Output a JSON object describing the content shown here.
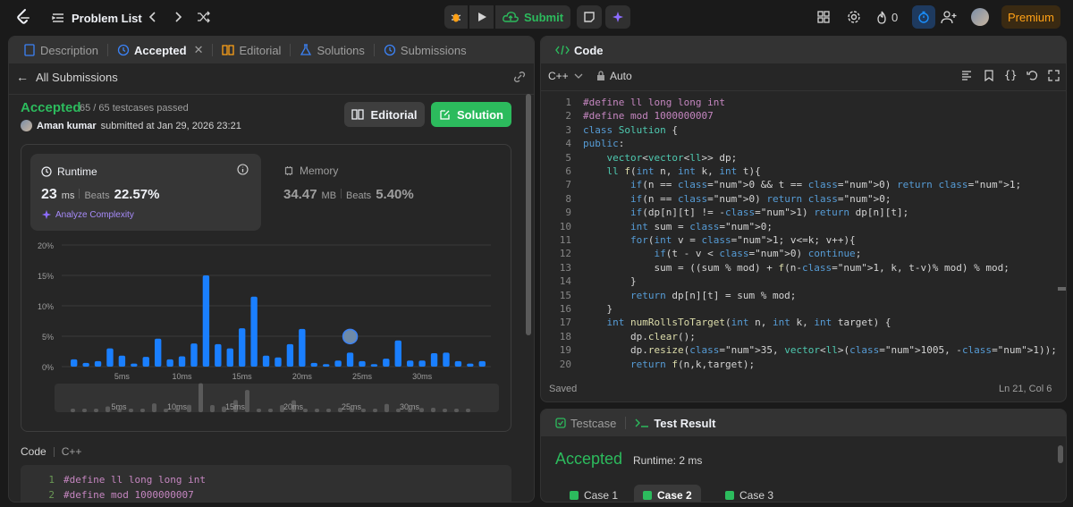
{
  "topbar": {
    "problem_list": "Problem List",
    "submit": "Submit",
    "streak_count": "0",
    "premium": "Premium",
    "icons": [
      "leetcode-logo-icon",
      "list-icon",
      "chevron-left-icon",
      "chevron-right-icon",
      "shuffle-icon",
      "debug-icon",
      "play-icon",
      "cloud-upload-icon",
      "note-icon",
      "sparkle-icon",
      "layout-icon",
      "gear-icon",
      "fire-icon",
      "timer-icon",
      "add-user-icon",
      "avatar"
    ]
  },
  "left_tabs": [
    {
      "label": "Description",
      "active": false
    },
    {
      "label": "Accepted",
      "active": true
    },
    {
      "label": "Editorial",
      "active": false
    },
    {
      "label": "Solutions",
      "active": false
    },
    {
      "label": "Submissions",
      "active": false
    }
  ],
  "submission": {
    "back_label": "All Submissions",
    "status": "Accepted",
    "testcases": "65 / 65 testcases passed",
    "author": "Aman kumar",
    "submitted_text": "submitted at Jan 29, 2026 23:21",
    "editorial_btn": "Editorial",
    "solution_btn": "Solution"
  },
  "runtime": {
    "label": "Runtime",
    "value": "23",
    "unit": "ms",
    "beats_label": "Beats",
    "beats": "22.57%",
    "analyze": "Analyze Complexity"
  },
  "memory": {
    "label": "Memory",
    "value": "34.47",
    "unit": "MB",
    "beats_label": "Beats",
    "beats": "5.40%"
  },
  "chart_data": {
    "type": "bar",
    "ylim": [
      0,
      20
    ],
    "yticks": [
      "0%",
      "5%",
      "10%",
      "15%",
      "20%"
    ],
    "xticks": [
      "5ms",
      "10ms",
      "15ms",
      "20ms",
      "25ms",
      "30ms"
    ],
    "mini_xticks": [
      "5ms",
      "10ms",
      "15ms",
      "20ms",
      "25ms",
      "30ms"
    ],
    "values": [
      1.2,
      0.6,
      0.9,
      3.0,
      1.8,
      0.5,
      1.6,
      4.6,
      1.2,
      1.7,
      3.8,
      15.0,
      3.7,
      3.0,
      6.3,
      11.5,
      1.8,
      1.5,
      3.7,
      6.2,
      0.6,
      0.4,
      1.0,
      2.3,
      0.9,
      0.4,
      1.3,
      4.3,
      1.0,
      1.0,
      2.2,
      2.3,
      0.9,
      0.5,
      0.9
    ],
    "highlight_index": 23,
    "color": "#1a7fff"
  },
  "code_section": {
    "label": "Code",
    "lang": "C++",
    "preview_lines": [
      "#define ll long long int",
      "#define mod 1000000007"
    ]
  },
  "code_panel": {
    "title": "Code",
    "lang": "C++",
    "mode": "Auto",
    "saved": "Saved",
    "cursor": "Ln 21, Col 6",
    "lines": [
      "#define ll long long int",
      "#define mod 1000000007",
      "class Solution {",
      "public:",
      "    vector<vector<ll>> dp;",
      "    ll f(int n, int k, int t){",
      "        if(n == 0 && t == 0) return 1;",
      "        if(n == 0) return 0;",
      "        if(dp[n][t] != -1) return dp[n][t];",
      "        int sum = 0;",
      "        for(int v = 1; v<=k; v++){",
      "            if(t - v < 0) continue;",
      "            sum = ((sum % mod) + f(n-1, k, t-v)% mod) % mod;",
      "        }",
      "        return dp[n][t] = sum % mod;",
      "    }",
      "    int numRollsToTarget(int n, int k, int target) {",
      "        dp.clear();",
      "        dp.resize(35, vector<ll>(1005, -1));",
      "        return f(n,k,target);"
    ]
  },
  "test_panel": {
    "tab_testcase": "Testcase",
    "tab_result": "Test Result",
    "status": "Accepted",
    "runtime": "Runtime: 2 ms",
    "cases": [
      "Case 1",
      "Case 2",
      "Case 3"
    ],
    "active_case": 1
  },
  "colors": {
    "accent_green": "#2cbb5d",
    "bar_blue": "#1a7fff",
    "premium": "#ffa116"
  }
}
